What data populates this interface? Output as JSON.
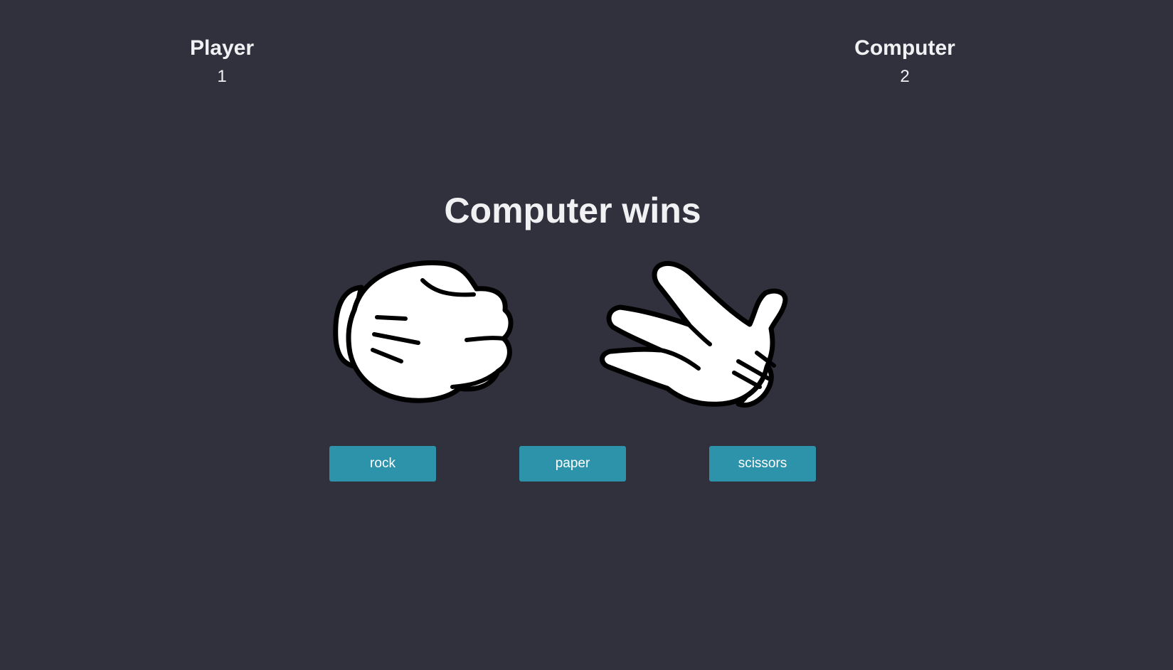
{
  "player": {
    "label": "Player",
    "score": "1",
    "choice_icon": "rock-glove-icon"
  },
  "computer": {
    "label": "Computer",
    "score": "2",
    "choice_icon": "scissors-glove-icon"
  },
  "result": "Computer wins",
  "buttons": [
    {
      "label": "rock"
    },
    {
      "label": "paper"
    },
    {
      "label": "scissors"
    }
  ],
  "colors": {
    "background": "#31313e",
    "text": "#f1f1f4",
    "button": "#2d93ab",
    "button_text": "#ffffff",
    "glove_fill": "#ffffff",
    "glove_outline": "#000000"
  }
}
